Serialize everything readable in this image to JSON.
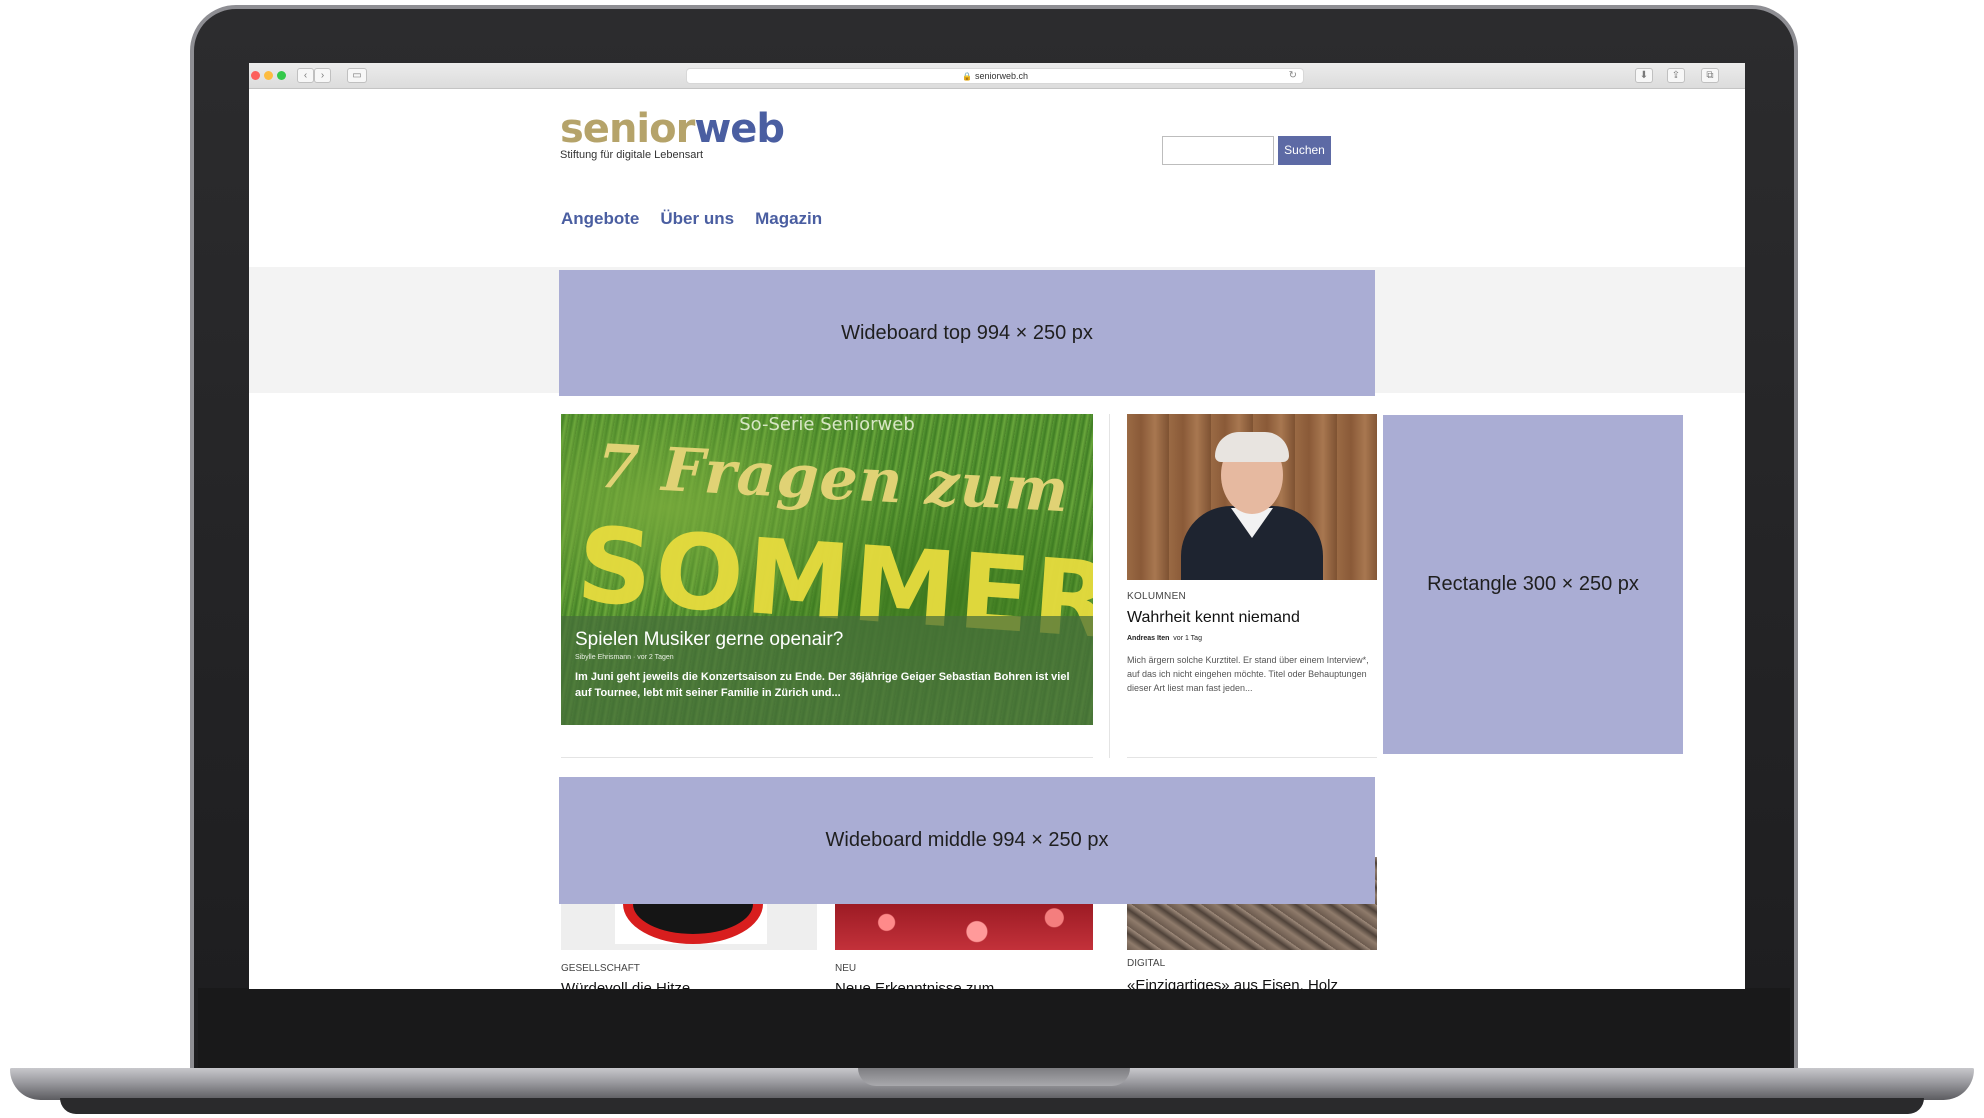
{
  "browser": {
    "url": "seniorweb.ch",
    "lock_icon": "lock-icon",
    "back_glyph": "‹",
    "forward_glyph": "›",
    "sidebar_glyph": "▭",
    "reload_glyph": "↻",
    "download_glyph": "⬇",
    "share_glyph": "⇪",
    "tabs_glyph": "⧉"
  },
  "site": {
    "logo_senior": "senior",
    "logo_web": "web",
    "tagline": "Stiftung für digitale Lebensart",
    "search_placeholder": "",
    "search_button": "Suchen",
    "nav": [
      "Angebote",
      "Über uns",
      "Magazin"
    ]
  },
  "ads": {
    "top": "Wideboard top 994 × 250 px",
    "rectangle": "Rectangle 300 × 250 px",
    "middle": "Wideboard middle 994 × 250 px"
  },
  "featured": {
    "image_series_label": "So-Serie Seniorweb",
    "image_headline": "7 Fragen zum",
    "image_word": "SOMMER",
    "title": "Spielen Musiker gerne openair?",
    "meta": "Sibylle Ehrismann  ·  vor 2 Tagen",
    "excerpt": "Im Juni geht jeweils die Konzertsaison zu Ende. Der 36jährige Geiger Sebastian Bohren ist viel auf Tournee, lebt mit seiner Familie in Zürich und..."
  },
  "column_card": {
    "category": "KOLUMNEN",
    "title": "Wahrheit kennt niemand",
    "author": "Andreas Iten",
    "time": "vor 1 Tag",
    "excerpt": "Mich ärgern solche Kurztitel. Er stand über einem Interview*, auf das ich nicht eingehen möchte. Titel oder Behauptungen dieser Art liest man fast jeden..."
  },
  "teasers": [
    {
      "category": "GESELLSCHAFT",
      "title": "Würdevoll die Hitze"
    },
    {
      "category": "NEU",
      "title": "Neue Erkenntnisse zum"
    },
    {
      "category": "DIGITAL",
      "title": "«Einzigartiges» aus Eisen, Holz"
    }
  ],
  "colors": {
    "brand_gold": "#b5a36a",
    "brand_blue": "#4a5ea1",
    "ad_placeholder": "#aaadd4",
    "search_button": "#5d6aa5"
  }
}
